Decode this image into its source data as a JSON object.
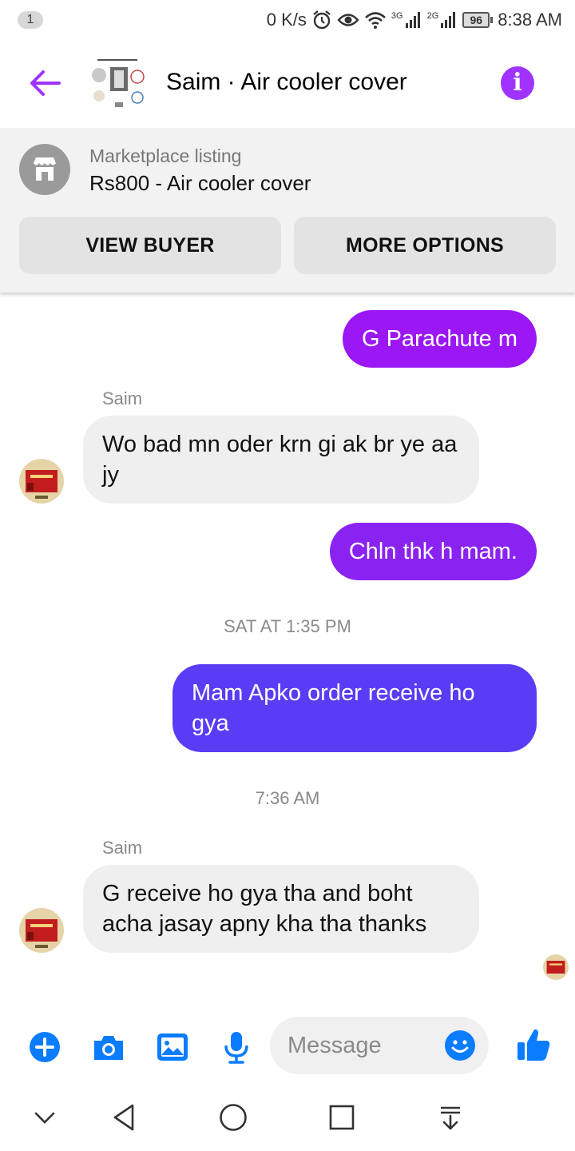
{
  "status_bar": {
    "notification_count": "1",
    "net_speed": "0 K/s",
    "network_1": "3G",
    "network_2": "2G",
    "battery": "96",
    "time": "8:38 AM"
  },
  "header": {
    "title": "Saim · Air cooler cover",
    "accent_color": "#a033ff"
  },
  "listing": {
    "label": "Marketplace listing",
    "title": "Rs800 - Air cooler cover",
    "view_buyer_label": "VIEW BUYER",
    "more_options_label": "MORE OPTIONS"
  },
  "messages": [
    {
      "direction": "out",
      "text": "G Parachute m",
      "color": "#9b17f5"
    },
    {
      "direction": "in",
      "sender": "Saim",
      "text": "Wo bad mn oder krn gi ak br ye aa jy"
    },
    {
      "direction": "out",
      "text": "Chln thk h mam.",
      "color": "#8a22f2"
    },
    {
      "direction": "separator",
      "text": "SAT AT 1:35 PM"
    },
    {
      "direction": "out",
      "text": "Mam Apko order receive ho gya",
      "color": "#5b3cf5"
    },
    {
      "direction": "separator",
      "text": "7:36 AM"
    },
    {
      "direction": "in",
      "sender": "Saim",
      "text": "G receive ho gya tha and boht acha jasay apny kha tha thanks"
    }
  ],
  "composer": {
    "placeholder": "Message",
    "icon_color": "#0a7cff",
    "icons": [
      "plus-icon",
      "camera-icon",
      "gallery-icon",
      "microphone-icon",
      "emoji-icon",
      "thumbs-up-icon"
    ]
  },
  "nav": {
    "icons": [
      "collapse-icon",
      "back-icon",
      "home-icon",
      "recents-icon",
      "notifications-pull-icon"
    ]
  }
}
